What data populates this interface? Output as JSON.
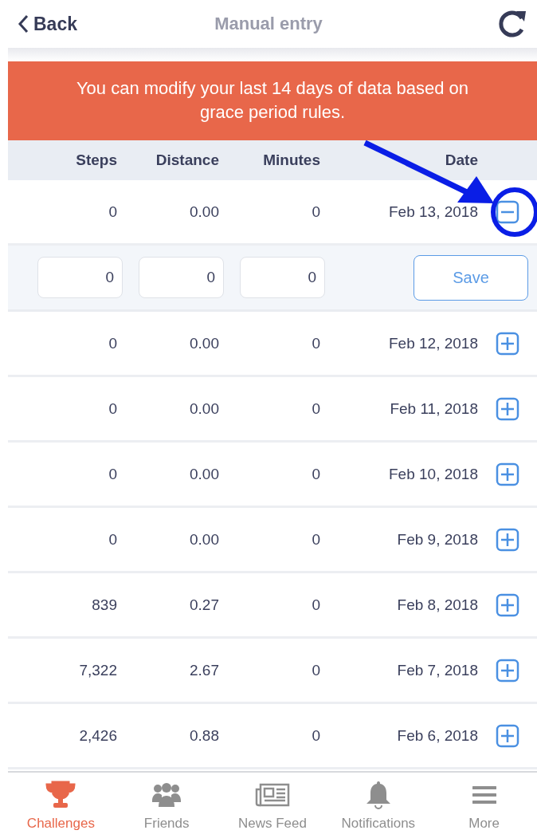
{
  "header": {
    "back": "Back",
    "title": "Manual entry"
  },
  "banner": "You can modify your last 14 days of data based on grace period rules.",
  "columns": [
    "Steps",
    "Distance",
    "Minutes",
    "Date"
  ],
  "rows": [
    {
      "steps": "0",
      "distance": "0.00",
      "minutes": "0",
      "date": "Feb 13, 2018",
      "expanded": true,
      "edit": {
        "steps": "0",
        "distance": "0",
        "minutes": "0",
        "save": "Save"
      }
    },
    {
      "steps": "0",
      "distance": "0.00",
      "minutes": "0",
      "date": "Feb 12, 2018",
      "expanded": false
    },
    {
      "steps": "0",
      "distance": "0.00",
      "minutes": "0",
      "date": "Feb 11, 2018",
      "expanded": false
    },
    {
      "steps": "0",
      "distance": "0.00",
      "minutes": "0",
      "date": "Feb 10, 2018",
      "expanded": false
    },
    {
      "steps": "0",
      "distance": "0.00",
      "minutes": "0",
      "date": "Feb 9, 2018",
      "expanded": false
    },
    {
      "steps": "839",
      "distance": "0.27",
      "minutes": "0",
      "date": "Feb 8, 2018",
      "expanded": false
    },
    {
      "steps": "7,322",
      "distance": "2.67",
      "minutes": "0",
      "date": "Feb 7, 2018",
      "expanded": false
    },
    {
      "steps": "2,426",
      "distance": "0.88",
      "minutes": "0",
      "date": "Feb 6, 2018",
      "expanded": false
    }
  ],
  "nav": [
    {
      "label": "Challenges",
      "kind": "trophy",
      "selected": true
    },
    {
      "label": "Friends",
      "kind": "people",
      "selected": false
    },
    {
      "label": "News Feed",
      "kind": "newspaper",
      "selected": false
    },
    {
      "label": "Notifications",
      "kind": "bell",
      "selected": false
    },
    {
      "label": "More",
      "kind": "menu",
      "selected": false
    }
  ]
}
